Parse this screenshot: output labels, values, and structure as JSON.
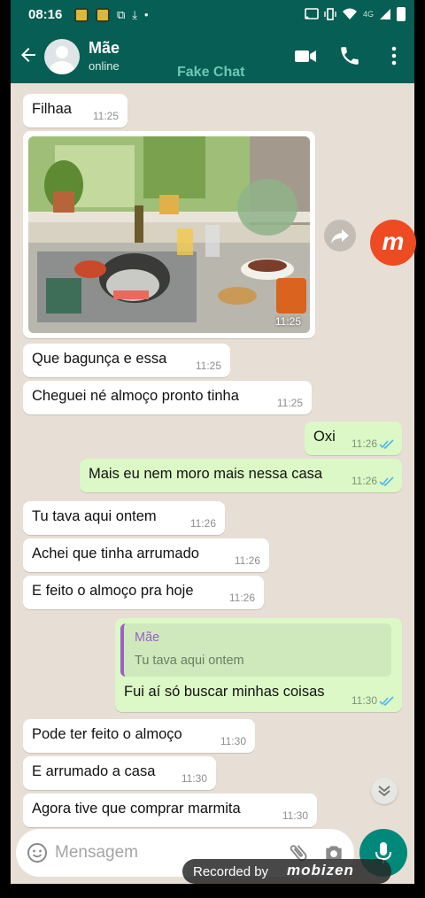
{
  "status_bar": {
    "time": "08:16",
    "network": "4G"
  },
  "header": {
    "contact_name": "Mãe",
    "contact_status": "online",
    "watermark": "Fake Chat",
    "icons": [
      "back-arrow-icon",
      "video-call-icon",
      "phone-icon",
      "more-vert-icon"
    ]
  },
  "messages": [
    {
      "dir": "in",
      "text": "Filhaa",
      "time": "11:25"
    },
    {
      "dir": "in",
      "type": "image",
      "caption_time": "11:25",
      "image_desc": "kitchen-sink-photo"
    },
    {
      "dir": "in",
      "text": "Que bagunça e essa",
      "time": "11:25"
    },
    {
      "dir": "in",
      "text": "Cheguei né almoço pronto tinha",
      "time": "11:25"
    },
    {
      "dir": "out",
      "text": "Oxi",
      "time": "11:26"
    },
    {
      "dir": "out",
      "text": "Mais eu nem moro mais nessa casa",
      "time": "11:26"
    },
    {
      "dir": "in",
      "text": "Tu tava aqui ontem",
      "time": "11:26"
    },
    {
      "dir": "in",
      "text": "Achei que tinha arrumado",
      "time": "11:26"
    },
    {
      "dir": "in",
      "text": "E feito o almoço pra hoje",
      "time": "11:26"
    },
    {
      "dir": "out",
      "quote_name": "Mãe",
      "quote_text": "Tu tava aqui ontem",
      "text": "Fui aí só buscar minhas coisas",
      "time": "11:30"
    },
    {
      "dir": "in",
      "text": "Pode ter feito o almoço",
      "time": "11:30"
    },
    {
      "dir": "in",
      "text": "E arrumado a casa",
      "time": "11:30"
    },
    {
      "dir": "in",
      "text": "Agora tive que comprar marmita",
      "time": "11:30"
    }
  ],
  "input": {
    "placeholder": "Mensagem"
  },
  "overlay": {
    "recorded_by": "Recorded by",
    "brand": "mobizen",
    "side_badge": "m"
  },
  "colors": {
    "header": "#075e54",
    "chat_bg": "#e7ded5",
    "outgoing": "#dcf8c6",
    "incoming": "#ffffff",
    "mic_button": "#00897b",
    "read_ticks": "#4fb6ec"
  }
}
